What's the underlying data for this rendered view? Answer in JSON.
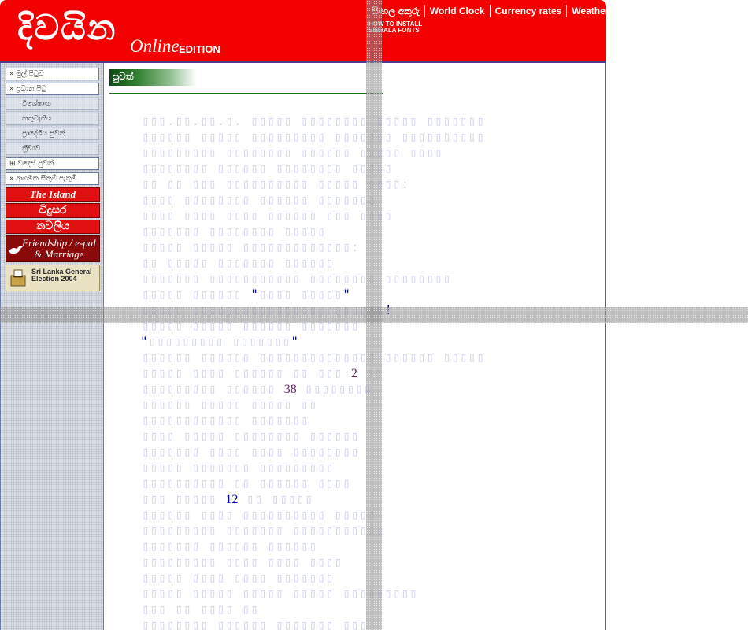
{
  "header": {
    "logo_text": "දිවයින",
    "logo_online": "Online",
    "logo_edition": "EDITION",
    "top_links": [
      "සිංහල අකුරු",
      "World Clock",
      "Currency rates",
      "Weather"
    ],
    "howto": "HOW TO INSTALL\nSINHALA FONTS"
  },
  "sidebar": {
    "items": [
      {
        "label": "මුල් පිටුව"
      },
      {
        "label": "ප්‍රධාන පිටු"
      },
      {
        "label": "විශේෂාංග"
      },
      {
        "label": "කතුවැකිය"
      },
      {
        "label": "ප්‍රාදේශීය පුවත්"
      },
      {
        "label": "ක්‍රීඩාව"
      },
      {
        "label": "විදෙස් පුවත්"
      },
      {
        "label": "ආගමික සිතුම් පැතුම්"
      }
    ],
    "banners": {
      "island": "The Island",
      "vidusara": "විදුසර",
      "navaliya": "නවලිය",
      "friendship": "Friendship / e-pal & Marriage",
      "election": "Sri Lanka General Election 2004"
    }
  },
  "main": {
    "section_label": "පුවත්",
    "numbers": {
      "n1": "2",
      "n2": "38",
      "n3": "12"
    },
    "quotes": {
      "q1": "\"",
      "q2": "\"",
      "q3": "!"
    },
    "dots_line": "...",
    "colons": ":"
  },
  "colors": {
    "header_red": "#f40000",
    "header_rule": "#4b3a8c",
    "section_green": "#0c4a14",
    "main_border": "#e02b3d",
    "glyph_placeholder": "#cfd2ec",
    "link_blue": "#0000cc"
  }
}
